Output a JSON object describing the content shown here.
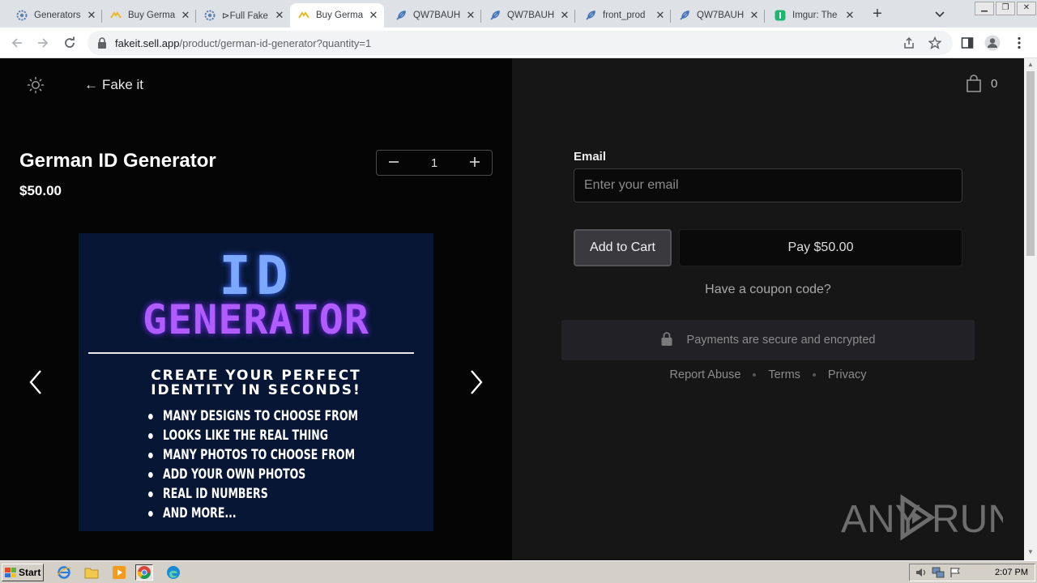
{
  "browser": {
    "tabs": [
      {
        "title": "Generators",
        "favicon": "gear-icon",
        "active": false
      },
      {
        "title": "Buy Germa",
        "favicon": "sellapp-icon",
        "active": false
      },
      {
        "title": "⊳Full Fake",
        "favicon": "gear-icon",
        "active": false
      },
      {
        "title": "Buy Germa",
        "favicon": "sellapp-icon",
        "active": true
      },
      {
        "title": "QW7BAUH",
        "favicon": "feather-icon",
        "active": false
      },
      {
        "title": "QW7BAUH",
        "favicon": "feather-icon",
        "active": false
      },
      {
        "title": "front_prod",
        "favicon": "feather-icon",
        "active": false
      },
      {
        "title": "QW7BAUH",
        "favicon": "feather-icon",
        "active": false
      },
      {
        "title": "Imgur: The",
        "favicon": "imgur-icon",
        "active": false
      }
    ],
    "url_host": "fakeit.sell.app",
    "url_path": "/product/german-id-generator?quantity=1"
  },
  "store": {
    "back_label": "Fake it",
    "cart_count": "0"
  },
  "product": {
    "title": "German ID Generator",
    "price": "$50.00",
    "quantity": "1",
    "image": {
      "line1": "ID",
      "line2": "GENERATOR",
      "tagline1": "CREATE YOUR PERFECT",
      "tagline2": "IDENTITY IN SECONDS!",
      "bullets": [
        "MANY DESIGNS TO CHOOSE FROM",
        "LOOKS LIKE THE REAL THING",
        "MANY PHOTOS TO CHOOSE FROM",
        "ADD YOUR OWN PHOTOS",
        "REAL ID NUMBERS",
        "AND MORE..."
      ]
    }
  },
  "checkout": {
    "email_label": "Email",
    "email_placeholder": "Enter your email",
    "add_to_cart": "Add to Cart",
    "pay_label": "Pay $50.00",
    "coupon": "Have a coupon code?",
    "secure_text": "Payments are secure and encrypted",
    "footer_links": [
      "Report Abuse",
      "Terms",
      "Privacy"
    ]
  },
  "watermark": "ANY RUN",
  "taskbar": {
    "start_label": "Start",
    "clock": "2:07 PM"
  }
}
